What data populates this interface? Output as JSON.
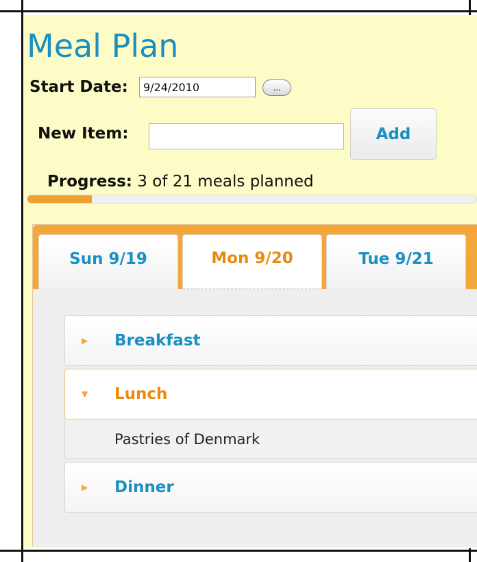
{
  "app": {
    "title": "Meal Plan"
  },
  "start_date": {
    "label": "Start Date:",
    "value": "9/24/2010",
    "picker_label": "..."
  },
  "new_item": {
    "label": "New Item:",
    "value": "",
    "button_label": "Add"
  },
  "progress": {
    "label": "Progress:",
    "text": "3 of 21 meals planned",
    "fraction": 0.1429
  },
  "tabs": [
    {
      "label": "Sun 9/19",
      "active": false
    },
    {
      "label": "Mon 9/20",
      "active": true
    },
    {
      "label": "Tue 9/21",
      "active": false
    }
  ],
  "meals": [
    {
      "label": "Breakfast",
      "expanded": false
    },
    {
      "label": "Lunch",
      "expanded": true,
      "items": [
        "Pastries of Denmark"
      ]
    },
    {
      "label": "Dinner",
      "expanded": false
    }
  ],
  "colors": {
    "accent": "#1a8fc2",
    "highlight": "#ea8b0e",
    "tabbar": "#f3a73b",
    "panel_bg": "#fdfcc6"
  },
  "icons": {
    "collapsed": "triangle-right-icon",
    "expanded": "triangle-down-icon"
  }
}
